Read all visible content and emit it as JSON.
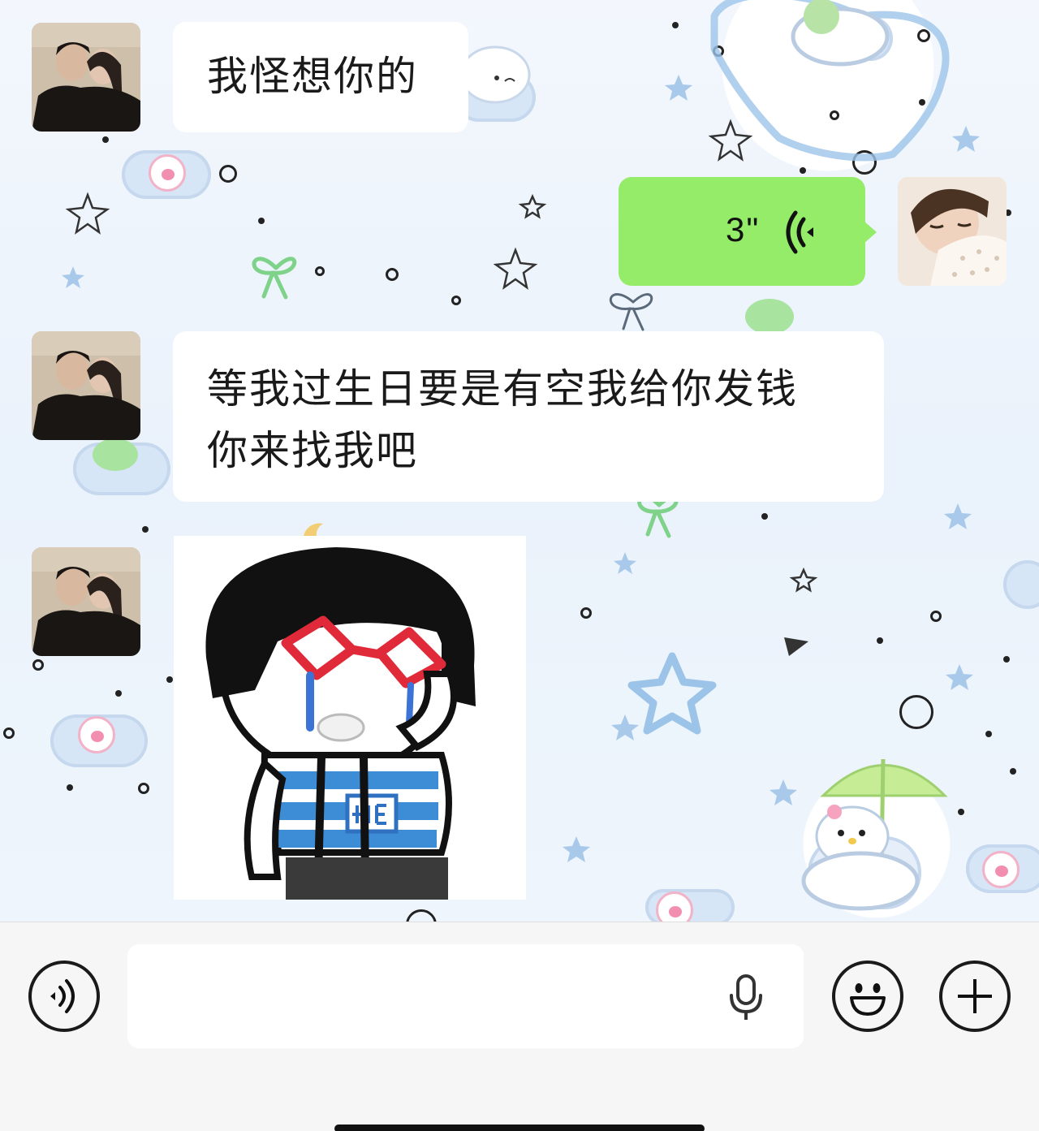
{
  "chat": {
    "messages": [
      {
        "sender": "contact",
        "type": "text",
        "lines": [
          "我怪想你的"
        ]
      },
      {
        "sender": "me",
        "type": "voice",
        "duration": "3\""
      },
      {
        "sender": "contact",
        "type": "text",
        "lines": [
          "等我过生日要是有空我给你发钱",
          "你来找我吧"
        ]
      },
      {
        "sender": "contact",
        "type": "sticker",
        "sticker_icon": "crying-bowl-cut-kid-sticker"
      }
    ]
  },
  "input_bar": {
    "voice_toggle_icon": "voice-mode-icon",
    "text_value": "",
    "mic_icon": "microphone-icon",
    "emoji_icon": "emoji-icon",
    "more_icon": "plus-icon"
  },
  "colors": {
    "voice_bubble": "#95ec69",
    "text_bubble": "#ffffff",
    "input_bar_bg": "#f6f6f6"
  }
}
